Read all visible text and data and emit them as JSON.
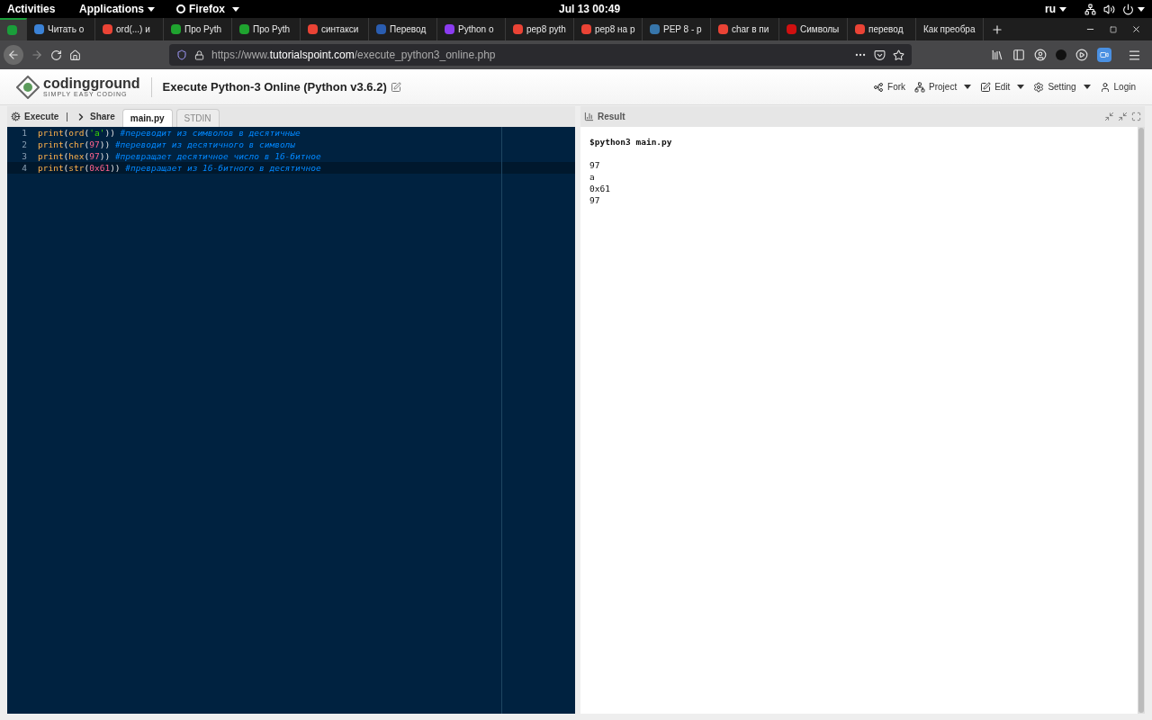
{
  "system_bar": {
    "activities": "Activities",
    "applications": "Applications",
    "app": "Firefox",
    "clock": "Jul 13  00:49",
    "language": "ru"
  },
  "browser_tabs": [
    {
      "selected": true,
      "color": "#1a9e3a"
    },
    {
      "title": "Читать о",
      "selected": false,
      "color": "#3b82d6"
    },
    {
      "title": "ord(...) и",
      "selected": false,
      "color": "#ea4335"
    },
    {
      "title": "Про Pyth",
      "selected": false,
      "color": "#1fa32f"
    },
    {
      "title": "Про Pyth",
      "selected": false,
      "color": "#1fa32f"
    },
    {
      "title": "синтакси",
      "selected": false,
      "color": "#ea4335"
    },
    {
      "title": "Перевод",
      "selected": false,
      "color": "#2a5db0"
    },
    {
      "title": "Python о",
      "selected": false,
      "color": "#8b3cf0"
    },
    {
      "title": "pep8 pyth",
      "selected": false,
      "color": "#ea4335"
    },
    {
      "title": "pep8 на р",
      "selected": false,
      "color": "#ea4335"
    },
    {
      "title": "PEP 8 - p",
      "selected": false,
      "color": "#3776ab"
    },
    {
      "title": "char в пи",
      "selected": false,
      "color": "#ea4335"
    },
    {
      "title": "Символы",
      "selected": false,
      "color": "#d01010"
    },
    {
      "title": "перевод",
      "selected": false,
      "color": "#ea4335"
    },
    {
      "title": "Как преобра",
      "selected": false
    }
  ],
  "url": {
    "prefix": "https://www.",
    "domain": "tutorialspoint.com",
    "path": "/execute_python3_online.php"
  },
  "site": {
    "logo_name": "codingground",
    "logo_tagline": "SIMPLY EASY CODING",
    "title": "Execute Python-3 Online (Python v3.6.2)",
    "menu": [
      {
        "label": "Fork",
        "kind": "fork",
        "dropdown": false
      },
      {
        "label": "Project",
        "kind": "project",
        "dropdown": true
      },
      {
        "label": "Edit",
        "kind": "edit",
        "dropdown": true
      },
      {
        "label": "Setting",
        "kind": "setting",
        "dropdown": true
      },
      {
        "label": "Login",
        "kind": "login",
        "dropdown": false
      }
    ]
  },
  "editor": {
    "execute": "Execute",
    "separator": "|",
    "share": "Share",
    "file_tabs": [
      {
        "label": "main.py",
        "selected": true
      },
      {
        "label": "STDIN",
        "selected": false
      }
    ],
    "lines": [
      {
        "number": "1",
        "active": false,
        "tokens": [
          {
            "kind": "func",
            "text": "print"
          },
          {
            "kind": "punct",
            "text": "("
          },
          {
            "kind": "func",
            "text": "ord"
          },
          {
            "kind": "punct",
            "text": "("
          },
          {
            "kind": "string",
            "text": "'a'"
          },
          {
            "kind": "punct",
            "text": "))"
          },
          {
            "kind": "comment",
            "text": " #переводит из символов в десятичные"
          }
        ]
      },
      {
        "number": "2",
        "active": false,
        "tokens": [
          {
            "kind": "func",
            "text": "print"
          },
          {
            "kind": "punct",
            "text": "("
          },
          {
            "kind": "func",
            "text": "chr"
          },
          {
            "kind": "punct",
            "text": "("
          },
          {
            "kind": "number",
            "text": "97"
          },
          {
            "kind": "punct",
            "text": "))"
          },
          {
            "kind": "comment",
            "text": " #переводит из десятичного в символы"
          }
        ]
      },
      {
        "number": "3",
        "active": false,
        "tokens": [
          {
            "kind": "func",
            "text": "print"
          },
          {
            "kind": "punct",
            "text": "("
          },
          {
            "kind": "func",
            "text": "hex"
          },
          {
            "kind": "punct",
            "text": "("
          },
          {
            "kind": "number",
            "text": "97"
          },
          {
            "kind": "punct",
            "text": "))"
          },
          {
            "kind": "comment",
            "text": " #превращает десятичное число в 16-битное"
          }
        ]
      },
      {
        "number": "4",
        "active": true,
        "tokens": [
          {
            "kind": "func",
            "text": "print"
          },
          {
            "kind": "punct",
            "text": "("
          },
          {
            "kind": "func",
            "text": "str"
          },
          {
            "kind": "punct",
            "text": "("
          },
          {
            "kind": "number",
            "text": "0x61"
          },
          {
            "kind": "punct",
            "text": "))"
          },
          {
            "kind": "comment",
            "text": " #превращает из 16-битного в десятичное"
          }
        ]
      }
    ]
  },
  "result": {
    "title": "Result",
    "command": "$python3 main.py",
    "output": [
      "97",
      "a",
      "0x61",
      "97"
    ]
  }
}
